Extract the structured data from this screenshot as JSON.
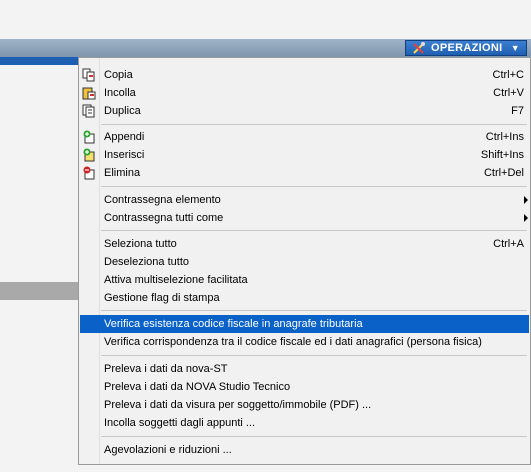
{
  "toolbar": {
    "operations_label": "OPERAZIONI"
  },
  "menu": {
    "copia": {
      "label": "Copia",
      "shortcut": "Ctrl+C",
      "icon": "copy-icon"
    },
    "incolla": {
      "label": "Incolla",
      "shortcut": "Ctrl+V",
      "icon": "paste-icon"
    },
    "duplica": {
      "label": "Duplica",
      "shortcut": "F7",
      "icon": "duplicate-icon"
    },
    "appendi": {
      "label": "Appendi",
      "shortcut": "Ctrl+Ins",
      "icon": "append-icon"
    },
    "inserisci": {
      "label": "Inserisci",
      "shortcut": "Shift+Ins",
      "icon": "insert-icon"
    },
    "elimina": {
      "label": "Elimina",
      "shortcut": "Ctrl+Del",
      "icon": "delete-icon"
    },
    "contrassegna_elemento": {
      "label": "Contrassegna elemento"
    },
    "contrassegna_tutti": {
      "label": "Contrassegna tutti come"
    },
    "seleziona_tutto": {
      "label": "Seleziona tutto",
      "shortcut": "Ctrl+A"
    },
    "deseleziona_tutto": {
      "label": "Deseleziona tutto"
    },
    "multiselezione": {
      "label": "Attiva multiselezione facilitata"
    },
    "flag_stampa": {
      "label": "Gestione flag di stampa"
    },
    "verifica_codice": {
      "label": "Verifica esistenza codice fiscale in anagrafe tributaria"
    },
    "verifica_corrispondenza": {
      "label": "Verifica corrispondenza tra il codice fiscale ed i dati anagrafici (persona fisica)"
    },
    "preleva_nova_st": {
      "label": "Preleva i dati da nova-ST"
    },
    "preleva_nova_studio": {
      "label": "Preleva i dati da NOVA Studio Tecnico"
    },
    "preleva_visura": {
      "label": "Preleva i dati da visura per soggetto/immobile (PDF) ..."
    },
    "incolla_soggetti": {
      "label": "Incolla soggetti dagli appunti ..."
    },
    "agevolazioni": {
      "label": "Agevolazioni e riduzioni ..."
    }
  },
  "colors": {
    "highlight": "#0a62c8",
    "button": "#1f5fb2"
  }
}
